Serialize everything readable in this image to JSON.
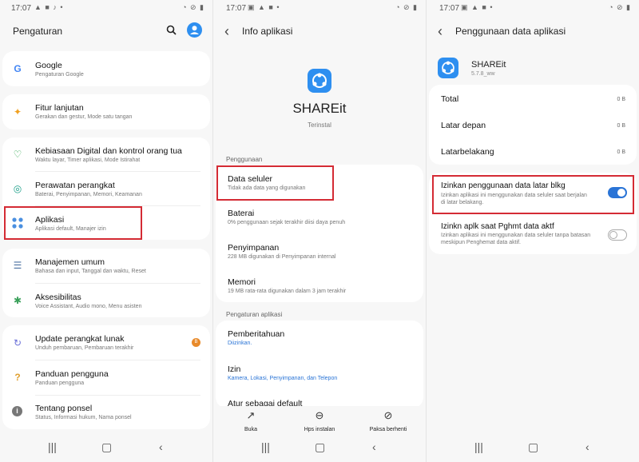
{
  "status": {
    "time": "17:07",
    "screens": [
      {
        "notif_icons": "▲ ■ ♪ •"
      },
      {
        "notif_icons": "▣ ▲ ■ •"
      },
      {
        "notif_icons": "▣ ▲ ■ •"
      }
    ],
    "sys_icons": "◔ ⊘ ▮"
  },
  "screen1": {
    "title": "Pengaturan",
    "items": [
      {
        "label": "Google",
        "sub": "Pengaturan Google",
        "icon": "G",
        "icon_color": "#4285f4"
      },
      {
        "label": "Fitur lanjutan",
        "sub": "Gerakan dan gestur, Mode satu tangan",
        "icon": "✦",
        "icon_color": "#f0a020"
      },
      {
        "label": "Kebiasaan Digital dan kontrol orang tua",
        "sub": "Waktu layar, Timer aplikasi, Mode Istirahat",
        "icon": "♡",
        "icon_color": "#3bab5a"
      },
      {
        "label": "Perawatan perangkat",
        "sub": "Baterai, Penyimpanan, Memori, Keamanan",
        "icon": "◎",
        "icon_color": "#1ea08a"
      },
      {
        "label": "Aplikasi",
        "sub": "Aplikasi default, Manajer izin",
        "icon": "⁘",
        "icon_color": "#4a8fe0"
      },
      {
        "label": "Manajemen umum",
        "sub": "Bahasa dan input, Tanggal dan waktu, Reset",
        "icon": "☰",
        "icon_color": "#4a6fa0"
      },
      {
        "label": "Aksesibilitas",
        "sub": "Voice Assistant, Audio mono, Menu asisten",
        "icon": "✱",
        "icon_color": "#3aa05a"
      },
      {
        "label": "Update perangkat lunak",
        "sub": "Unduh pembaruan, Pembaruan terakhir",
        "icon": "↻",
        "icon_color": "#6b70d8",
        "badge": "B"
      },
      {
        "label": "Panduan pengguna",
        "sub": "Panduan pengguna",
        "icon": "?",
        "icon_color": "#e0a030"
      },
      {
        "label": "Tentang ponsel",
        "sub": "Status, Informasi hukum, Nama ponsel",
        "icon": "i",
        "icon_color": "#777"
      }
    ]
  },
  "screen2": {
    "title": "Info aplikasi",
    "app_name": "SHAREit",
    "app_status": "Terinstal",
    "section_usage": "Penggunaan",
    "usage": [
      {
        "label": "Data seluler",
        "sub": "Tidak ada data yang digunakan"
      },
      {
        "label": "Baterai",
        "sub": "0% penggunaan sejak terakhir diisi daya penuh"
      },
      {
        "label": "Penyimpanan",
        "sub": "228 MB digunakan di Penyimpanan internal"
      },
      {
        "label": "Memori",
        "sub": "19 MB rata-rata digunakan dalam 3 jam terakhir"
      }
    ],
    "section_settings": "Pengaturan aplikasi",
    "settings": [
      {
        "label": "Pemberitahuan",
        "sub": "Diizinkan."
      },
      {
        "label": "Izin",
        "sub": "Kamera, Lokasi, Penyimpanan, dan Telepon"
      },
      {
        "label": "Atur sebagai default",
        "sub": ""
      }
    ],
    "bottom": [
      {
        "label": "Buka",
        "icon": "↗"
      },
      {
        "label": "Hps instalan",
        "icon": "⊖"
      },
      {
        "label": "Paksa berhenti",
        "icon": "⊘"
      }
    ]
  },
  "screen3": {
    "title": "Penggunaan data aplikasi",
    "app_name": "SHAREit",
    "app_version": "5.7.8_ww",
    "usage": [
      {
        "label": "Total",
        "value": "0 B"
      },
      {
        "label": "Latar depan",
        "value": "0 B"
      },
      {
        "label": "Latarbelakang",
        "value": "0 B"
      }
    ],
    "toggles": [
      {
        "label": "Izinkan penggunaan data latar blkg",
        "sub1": "Izinkan aplikasi ini menggunakan data seluler saat berjalan",
        "sub2": "di latar belakang.",
        "state": "on"
      },
      {
        "label": "Izinkn aplk saat Pghmt data aktf",
        "sub1": "Izinkan aplikasi ini menggunakan data seluler tanpa batasan",
        "sub2": "meskipun Penghemat data aktif.",
        "state": "off"
      }
    ]
  },
  "colors": {
    "accent": "#2a74d6",
    "highlight_box": "#d42b34",
    "shareit_blue": "#2e8ff0"
  }
}
